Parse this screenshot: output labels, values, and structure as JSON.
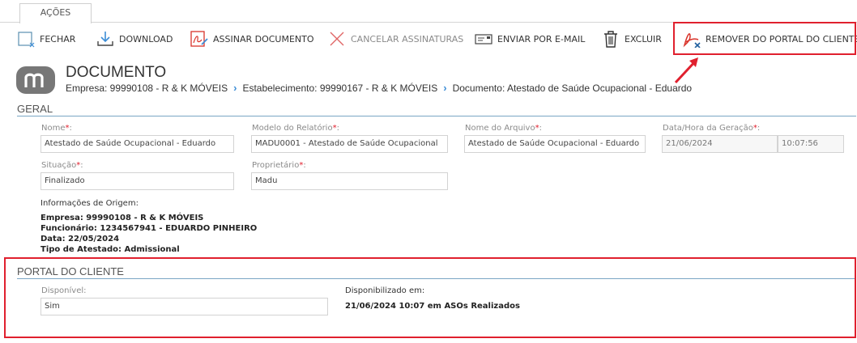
{
  "tabs": [
    {
      "label": "AÇÕES"
    }
  ],
  "toolbar": {
    "close": "FECHAR",
    "download": "DOWNLOAD",
    "sign": "ASSINAR DOCUMENTO",
    "cancel_signatures": "CANCELAR ASSINATURAS",
    "send_email": "ENVIAR POR E-MAIL",
    "delete": "EXCLUIR",
    "remove_portal": "REMOVER DO PORTAL DO CLIENTE"
  },
  "header": {
    "title": "DOCUMENTO",
    "breadcrumb": [
      "Empresa: 99990108 - R & K MÓVEIS",
      "Estabelecimento: 99990167 - R & K MÓVEIS",
      "Documento: Atestado de Saúde Ocupacional - Eduardo"
    ]
  },
  "geral": {
    "title": "GERAL",
    "nome": {
      "label": "Nome",
      "value": "Atestado de Saúde Ocupacional - Eduardo"
    },
    "modelo": {
      "label": "Modelo do Relatório",
      "value": "MADU0001 - Atestado de Saúde Ocupacional"
    },
    "arquivo": {
      "label": "Nome do Arquivo",
      "value": "Atestado de Saúde Ocupacional - Eduardo"
    },
    "geracao": {
      "label": "Data/Hora da Geração",
      "date": "21/06/2024",
      "time": "10:07:56"
    },
    "situacao": {
      "label": "Situação",
      "value": "Finalizado"
    },
    "proprietario": {
      "label": "Proprietário",
      "value": "Madu"
    },
    "origem": {
      "label": "Informações de Origem:",
      "lines": [
        "Empresa: 99990108 - R & K MÓVEIS",
        "Funcionário: 1234567941 - EDUARDO PINHEIRO",
        "Data: 22/05/2024",
        "Tipo de Atestado: Admissional"
      ]
    }
  },
  "portal": {
    "title": "PORTAL DO CLIENTE",
    "disponivel": {
      "label": "Disponível:",
      "value": "Sim"
    },
    "disponibilizado": {
      "label": "Disponibilizado em:",
      "value": "21/06/2024 10:07 em ASOs Realizados"
    }
  },
  "colors": {
    "accent": "#3c8dd6",
    "highlight": "#e0202e",
    "pdf_red": "#d9342b"
  }
}
